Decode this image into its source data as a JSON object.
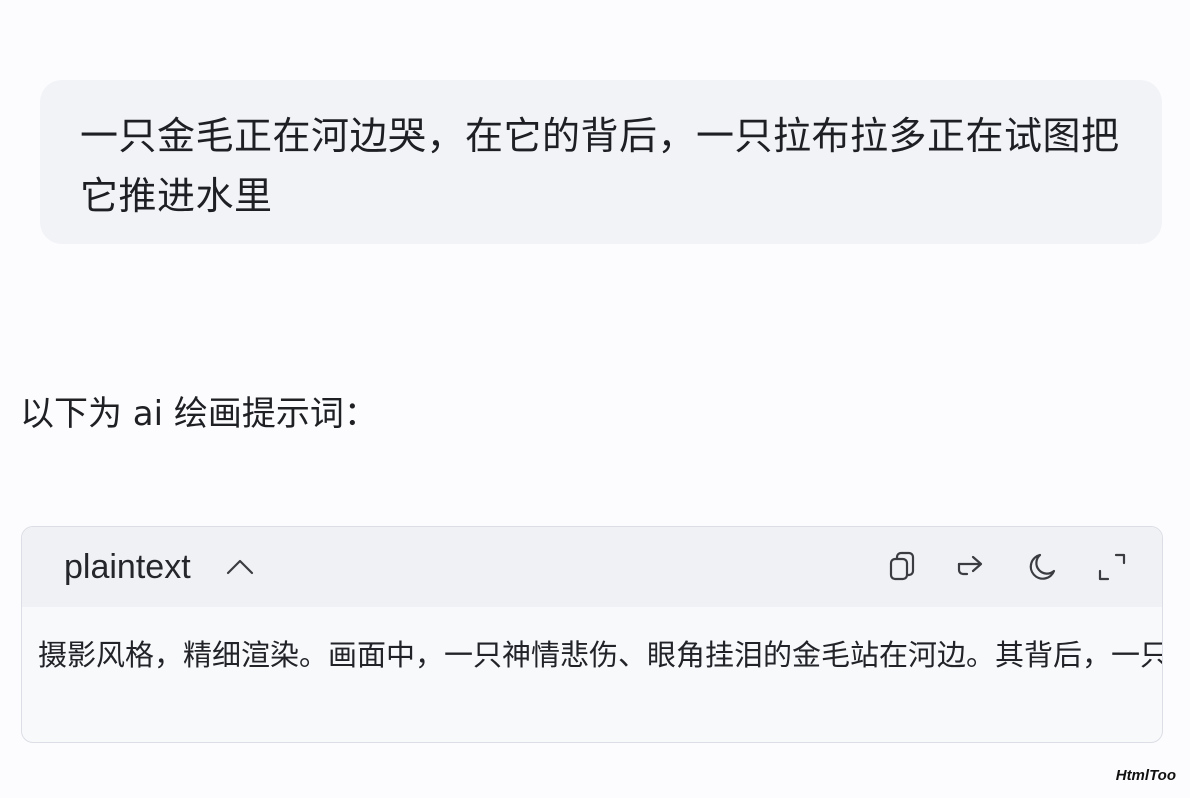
{
  "conversation": {
    "user_message": "一只金毛正在河边哭，在它的背后，一只拉布拉多正在试图把它推进水里",
    "reply_intro": "以下为 ai 绘画提示词："
  },
  "code_block": {
    "language": "plaintext",
    "content": "摄影风格，精细渲染。画面中，一只神情悲伤、眼角挂泪的金毛站在河边。其背后，一只拉布拉多正在试图把它推进水里。",
    "toolbar_icons": [
      "copy-icon",
      "share-arrow-icon",
      "dark-mode-moon-icon",
      "expand-icon"
    ]
  },
  "watermark": "HtmlToo"
}
